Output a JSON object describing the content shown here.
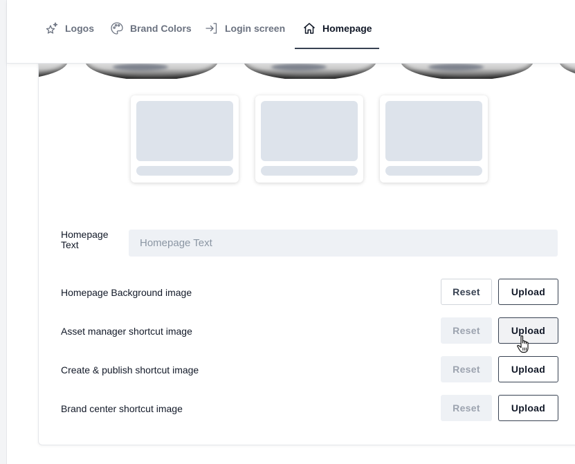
{
  "tabs": [
    {
      "label": "Logos",
      "icon": "sparkles-icon"
    },
    {
      "label": "Brand Colors",
      "icon": "palette-icon"
    },
    {
      "label": "Login screen",
      "icon": "login-arrow-icon"
    },
    {
      "label": "Homepage",
      "icon": "home-icon",
      "active": true
    }
  ],
  "homepage_text": {
    "label": "Homepage Text",
    "placeholder": "Homepage Text",
    "value": ""
  },
  "image_rows": [
    {
      "label": "Homepage Background image",
      "reset": "Reset",
      "upload": "Upload",
      "reset_enabled": true
    },
    {
      "label": "Asset manager shortcut image",
      "reset": "Reset",
      "upload": "Upload",
      "reset_enabled": false
    },
    {
      "label": "Create & publish shortcut image",
      "reset": "Reset",
      "upload": "Upload",
      "reset_enabled": false
    },
    {
      "label": "Brand center shortcut image",
      "reset": "Reset",
      "upload": "Upload",
      "reset_enabled": false
    }
  ],
  "colors": {
    "accent": "#374151",
    "placeholder_block": "#dde3eb",
    "input_bg": "#eef1f5"
  }
}
